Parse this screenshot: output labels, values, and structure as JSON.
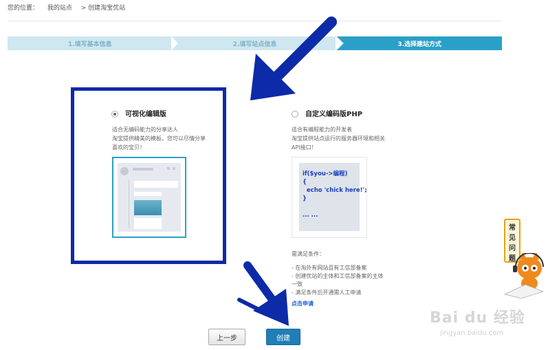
{
  "breadcrumb": {
    "label": "您的位置：",
    "items": [
      "我的站点",
      "> 创建淘宝优站"
    ]
  },
  "steps": [
    {
      "label": "1.填写基本信息",
      "active": false
    },
    {
      "label": "2.填写站点信息",
      "active": false
    },
    {
      "label": "3.选择建站方式",
      "active": true
    }
  ],
  "option_visual": {
    "title": "可视化编辑版",
    "checked": true,
    "desc_lines": [
      "适合无编码能力的分享达人",
      "淘宝提供精美的模板，您可以尽情分享",
      "喜欢的宝贝！"
    ]
  },
  "option_code": {
    "title": "自定义编码版PHP",
    "checked": false,
    "desc_lines": [
      "适合有编程能力的开发者",
      "淘宝提供站点运行的服务器环境和相关",
      "API接口！"
    ],
    "code_lines": [
      "if($you->编程)",
      "{",
      "  echo 'chick here!';",
      "}",
      "",
      "... ..."
    ],
    "conditions_title": "需满足条件：",
    "conditions": [
      "- 在淘外有网站且有工信部备案",
      "- 创建优站的主体和工信部备案的主体",
      "一致",
      "- 满足条件后开通需人工申请"
    ],
    "apply_link": "点击申请"
  },
  "buttons": {
    "prev": "上一步",
    "create": "创建"
  },
  "help": {
    "chars": [
      "常",
      "见",
      "问",
      "题"
    ]
  },
  "watermark": {
    "brand": "Bai du 经验",
    "url": "jingyan.baidu.com"
  },
  "colors": {
    "accent": "#2aa0c8",
    "highlight": "#0d2aa8",
    "create": "#1f7eb5"
  }
}
